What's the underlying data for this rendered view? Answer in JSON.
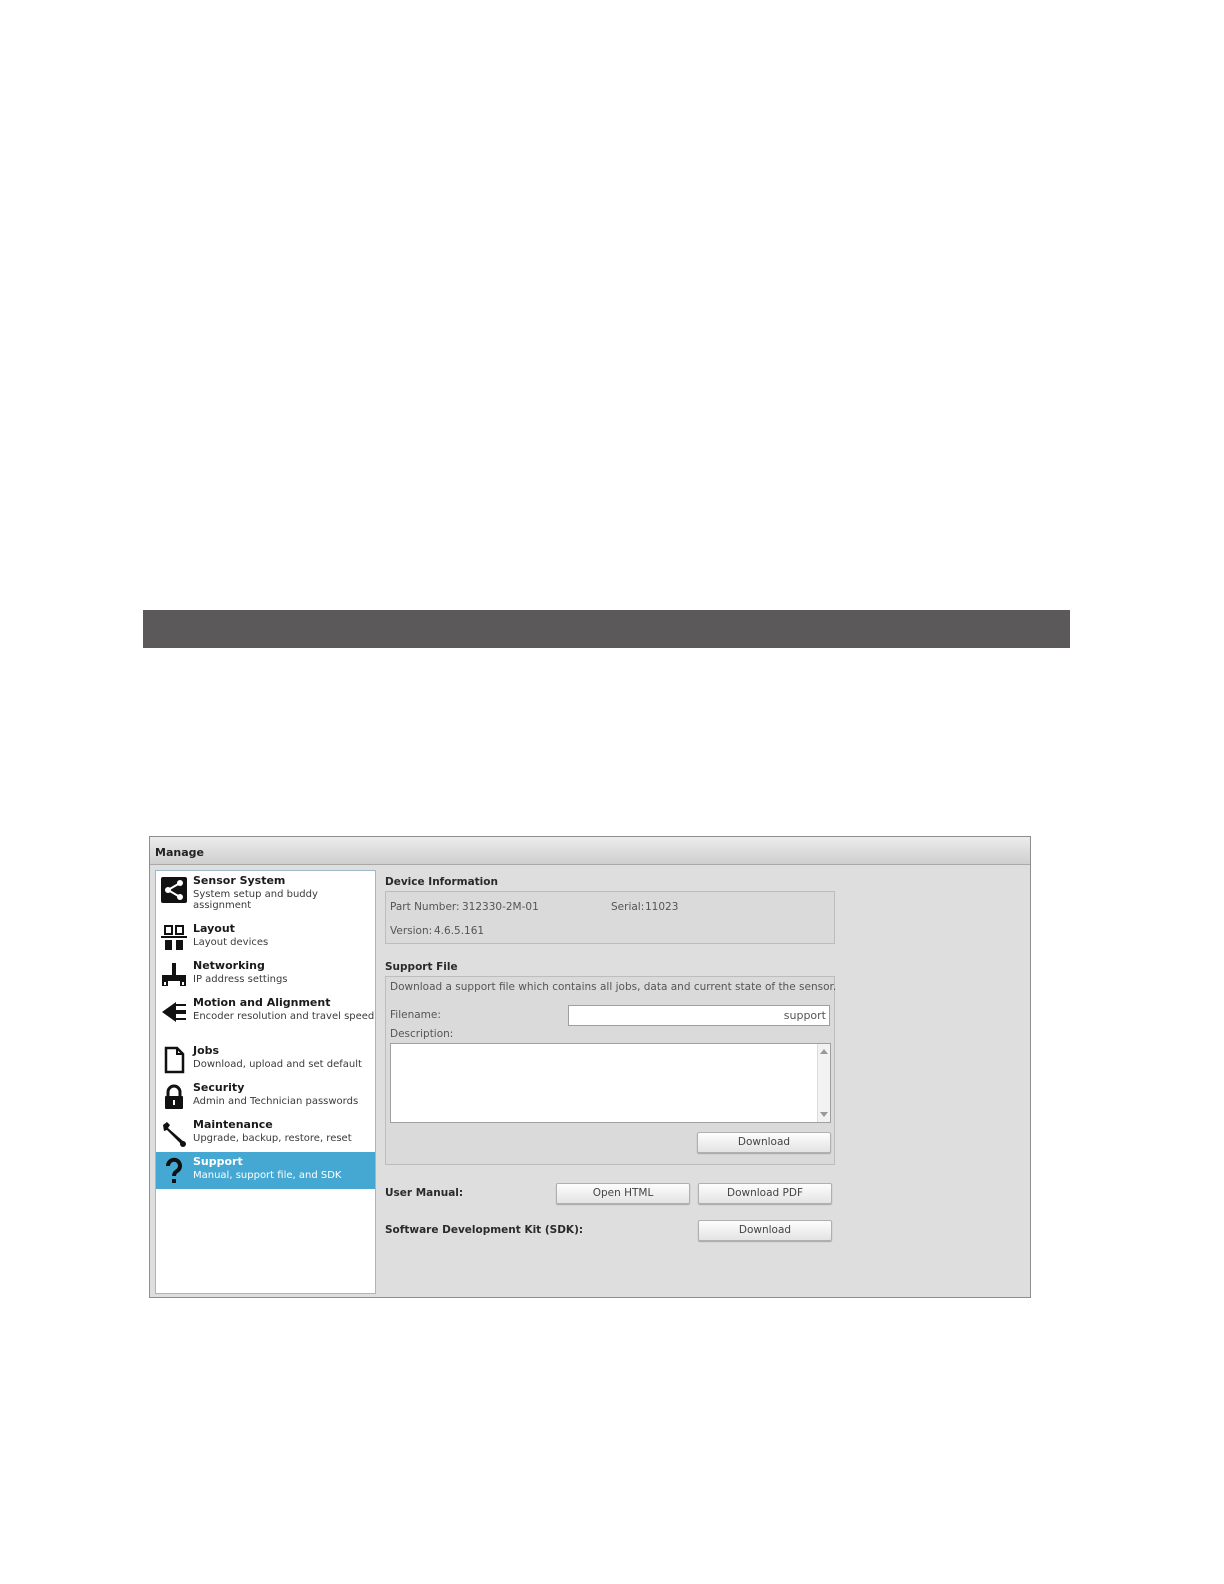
{
  "window": {
    "title": "Manage"
  },
  "sidebar": {
    "items": [
      {
        "title": "Sensor System",
        "subtitle": "System setup and buddy assignment",
        "icon": "share-icon"
      },
      {
        "title": "Layout",
        "subtitle": "Layout devices",
        "icon": "layout-icon"
      },
      {
        "title": "Networking",
        "subtitle": "IP address settings",
        "icon": "network-icon"
      },
      {
        "title": "Motion and Alignment",
        "subtitle": "Encoder resolution and travel speed",
        "icon": "arrow-left-icon"
      },
      {
        "title": "Jobs",
        "subtitle": "Download, upload and set default",
        "icon": "document-icon"
      },
      {
        "title": "Security",
        "subtitle": "Admin and Technician passwords",
        "icon": "lock-icon"
      },
      {
        "title": "Maintenance",
        "subtitle": "Upgrade, backup, restore, reset",
        "icon": "wrench-icon"
      },
      {
        "title": "Support",
        "subtitle": "Manual, support file, and SDK",
        "icon": "question-icon"
      }
    ],
    "selected": "Support",
    "selected_color": "#45a8d3"
  },
  "device_info": {
    "label": "Device Information",
    "part_number_label": "Part Number:",
    "part_number": "312330-2M-01",
    "serial_label": "Serial:",
    "serial": "11023",
    "version_label": "Version:",
    "version": "4.6.5.161"
  },
  "support_file": {
    "label": "Support File",
    "description_text": "Download a support file which contains all jobs, data and current state of the sensor.",
    "filename_label": "Filename:",
    "filename_value": "support",
    "description_label": "Description:",
    "description_value": "",
    "download_label": "Download"
  },
  "user_manual": {
    "label": "User Manual:",
    "open_html_label": "Open HTML",
    "download_pdf_label": "Download PDF"
  },
  "sdk": {
    "label": "Software Development Kit (SDK):",
    "download_label": "Download"
  }
}
